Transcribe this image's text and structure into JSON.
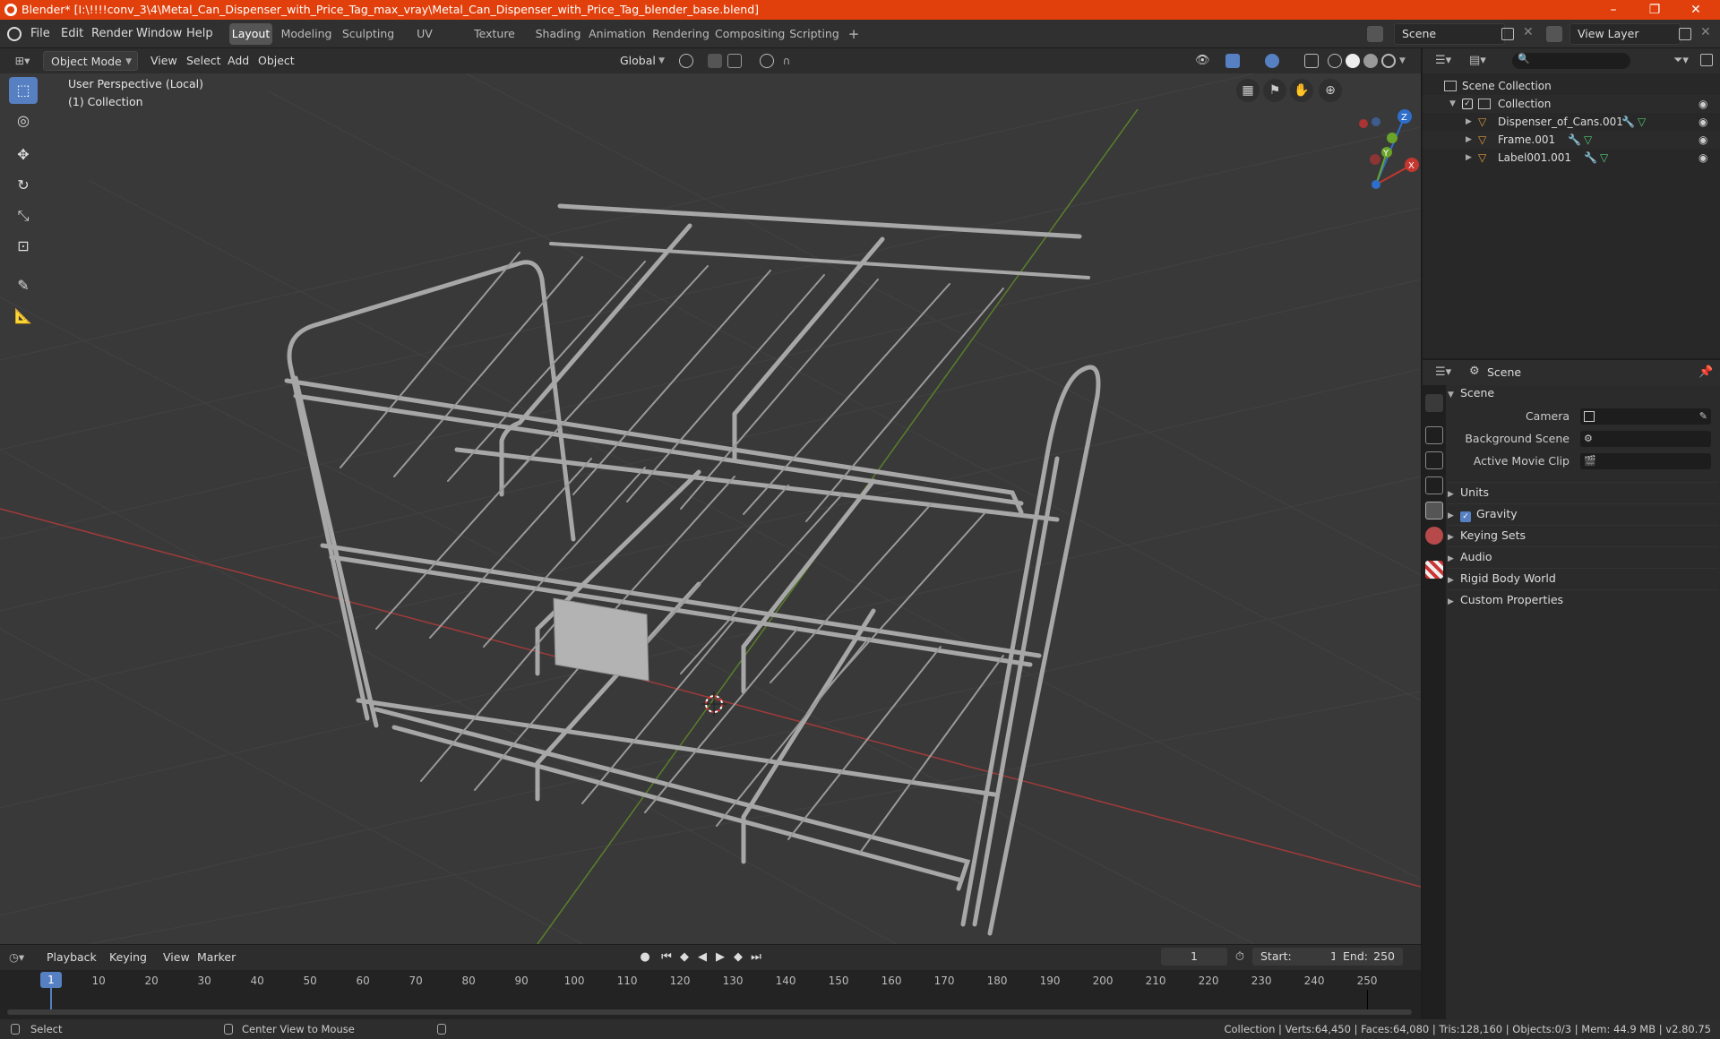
{
  "window": {
    "title": "Blender* [I:\\!!!!conv_3\\4\\Metal_Can_Dispenser_with_Price_Tag_max_vray\\Metal_Can_Dispenser_with_Price_Tag_blender_base.blend]",
    "minimize": "–",
    "maximize": "❐",
    "close": "✕"
  },
  "menubar": {
    "items": [
      "File",
      "Edit",
      "Render",
      "Window",
      "Help"
    ]
  },
  "workspaces": {
    "tabs": [
      "Layout",
      "Modeling",
      "Sculpting",
      "UV Editing",
      "Texture Paint",
      "Shading",
      "Animation",
      "Rendering",
      "Compositing",
      "Scripting"
    ],
    "active": "Layout",
    "add": "+"
  },
  "scene_selector": {
    "value": "Scene"
  },
  "view_layer_selector": {
    "value": "View Layer"
  },
  "viewport_header": {
    "mode": "Object Mode",
    "menus": [
      "View",
      "Select",
      "Add",
      "Object"
    ],
    "transform_orientation": "Global"
  },
  "viewport": {
    "perspective_label": "User Perspective (Local)",
    "collection_label": "(1) Collection",
    "gizmo_axes": {
      "x": "X",
      "y": "Y",
      "z": "Z"
    }
  },
  "outliner": {
    "root": "Scene Collection",
    "collection": "Collection",
    "objects": [
      "Dispenser_of_Cans.001",
      "Frame.001",
      "Label001.001"
    ]
  },
  "properties": {
    "header_title": "Scene",
    "section": "Scene",
    "fields": [
      {
        "label": "Camera"
      },
      {
        "label": "Background Scene"
      },
      {
        "label": "Active Movie Clip"
      }
    ],
    "panels": [
      "Units",
      "Gravity",
      "Keying Sets",
      "Audio",
      "Rigid Body World",
      "Custom Properties"
    ],
    "gravity_checked": true
  },
  "timeline": {
    "menus": [
      "Playback",
      "Keying",
      "View",
      "Marker"
    ],
    "current_frame": "1",
    "start_label": "Start:",
    "start": "1",
    "end_label": "End:",
    "end": "250",
    "ticks": [
      "1",
      "10",
      "20",
      "30",
      "40",
      "50",
      "60",
      "70",
      "80",
      "90",
      "100",
      "110",
      "120",
      "130",
      "140",
      "150",
      "160",
      "170",
      "180",
      "190",
      "200",
      "210",
      "220",
      "230",
      "240",
      "250"
    ]
  },
  "statusbar": {
    "left": "Select",
    "middle": "Center View to Mouse",
    "right": "Collection | Verts:64,450 | Faces:64,080 | Tris:128,160 | Objects:0/3 | Mem: 44.9 MB | v2.80.75"
  },
  "colors": {
    "title_bar": "#e1400c",
    "accent_blue": "#5680c2",
    "axis_x": "#c3372f",
    "axis_y": "#6aa32a",
    "axis_z": "#2e6ecb"
  }
}
